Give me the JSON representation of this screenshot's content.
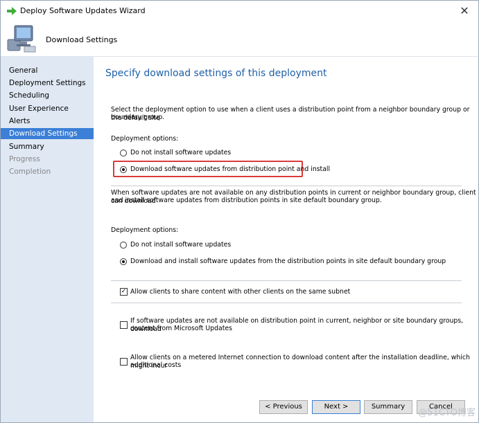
{
  "window": {
    "title": "Deploy Software Updates Wizard",
    "close_glyph": "✕"
  },
  "header": {
    "title": "Download Settings"
  },
  "sidebar": {
    "items": [
      {
        "label": "General",
        "state": "normal"
      },
      {
        "label": "Deployment Settings",
        "state": "normal"
      },
      {
        "label": "Scheduling",
        "state": "normal"
      },
      {
        "label": "User Experience",
        "state": "normal"
      },
      {
        "label": "Alerts",
        "state": "normal"
      },
      {
        "label": "Download Settings",
        "state": "active"
      },
      {
        "label": "Summary",
        "state": "normal"
      },
      {
        "label": "Progress",
        "state": "disabled"
      },
      {
        "label": "Completion",
        "state": "disabled"
      }
    ]
  },
  "main": {
    "title": "Specify download settings of this deployment",
    "intro_line1": "Select the deployment option to use when a client uses a distribution point from a neighbor boundary group or the default site",
    "intro_line2": "boundary group.",
    "group1": {
      "label": "Deployment options:",
      "option1": "Do not install software updates",
      "option2": "Download software updates from distribution point and install",
      "selected": 2
    },
    "info_line1": "When software updates are not available on any distribution points in current or neighbor boundary group, client can download",
    "info_line2": "and install software updates from distribution points in site default boundary group.",
    "group2": {
      "label": "Deployment options:",
      "option1": "Do not install software updates",
      "option2": "Download and install software updates from the distribution points in site default boundary group",
      "selected": 2
    },
    "checkbox1": {
      "label": "Allow clients to share content with other clients on the same subnet",
      "checked": true
    },
    "checkbox2": {
      "line1": "If software updates are not available on distribution point in current, neighbor or site boundary groups, download",
      "line2": "content from Microsoft Updates",
      "checked": false
    },
    "checkbox3": {
      "line1": "Allow clients on a metered Internet connection to download content after the installation deadline, which might incur",
      "line2": "additional costs",
      "checked": false
    }
  },
  "buttons": {
    "previous": "< Previous",
    "next": "Next >",
    "summary": "Summary",
    "cancel": "Cancel"
  },
  "watermark": "@51CTO博客",
  "colors": {
    "accent": "#3b7fd6",
    "title_blue": "#1e5fa8",
    "sidebar_bg": "#dfe8f3",
    "highlight": "#d93a3a"
  }
}
